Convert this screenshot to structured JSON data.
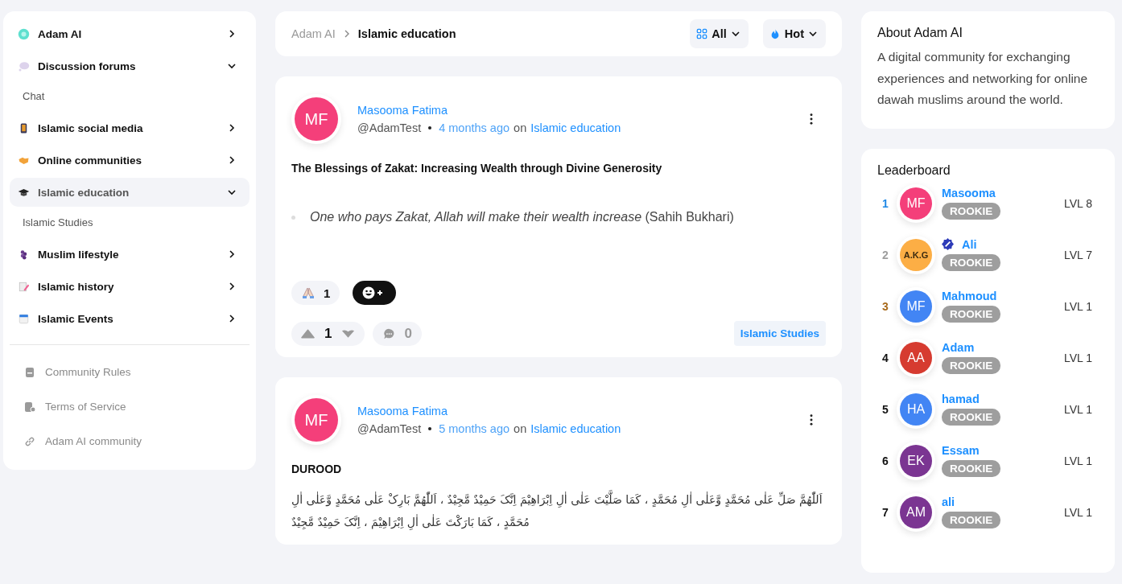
{
  "sidebar": {
    "items": [
      {
        "label": "Adam AI",
        "expanded": false,
        "selected": false
      },
      {
        "label": "Discussion forums",
        "expanded": true,
        "selected": false,
        "children": [
          {
            "label": "Chat"
          }
        ]
      },
      {
        "label": "Islamic social media",
        "expanded": false,
        "selected": false
      },
      {
        "label": "Online communities",
        "expanded": false,
        "selected": false
      },
      {
        "label": "Islamic education",
        "expanded": true,
        "selected": true,
        "children": [
          {
            "label": "Islamic Studies"
          }
        ]
      },
      {
        "label": "Muslim lifestyle",
        "expanded": false,
        "selected": false
      },
      {
        "label": "Islamic history",
        "expanded": false,
        "selected": false
      },
      {
        "label": "Islamic Events",
        "expanded": false,
        "selected": false
      }
    ],
    "links": [
      {
        "label": "Community Rules"
      },
      {
        "label": "Terms of Service"
      },
      {
        "label": "Adam AI community"
      }
    ]
  },
  "breadcrumb": {
    "parent": "Adam AI",
    "current": "Islamic education"
  },
  "filters": [
    {
      "label": "All"
    },
    {
      "label": "Hot"
    }
  ],
  "posts": [
    {
      "avatar": "MF",
      "color": "#f43f7a",
      "author": "Masooma Fatima",
      "handle": "@AdamTest",
      "time": "4 months ago",
      "on": "on",
      "community": "Islamic education",
      "title": "The Blessings of Zakat: Increasing Wealth through Divine Generosity",
      "kind": "quote",
      "body": "*One who pays Zakat, Allah will make their wealth increase* (Sahih Bukhari)",
      "reactions": [
        {
          "count": "1"
        }
      ],
      "votes": "1",
      "comments": "0",
      "tag": "Islamic Studies"
    },
    {
      "avatar": "MF",
      "color": "#f43f7a",
      "author": "Masooma Fatima",
      "handle": "@AdamTest",
      "time": "5 months ago",
      "on": "on",
      "community": "Islamic education",
      "title": "DUROOD",
      "kind": "arabic",
      "body": "اَللّٰهُمَّ صَلِّ عَلٰی مُحَمَّدٍ وَّعَلٰی اٰلِ مُحَمَّدٍ ، کَمَا صَلَّیْتَ عَلٰی اٰلِ اِبْرَاهِیْمَ اِنَّکَ حَمِیْدٌ مَّجِیْدٌ ، اَللّٰهُمَّ بَارِکْ عَلٰی مُحَمَّدٍ وَّعَلٰی اٰلِ مُحَمَّدٍ ، کَمَا بَارَکْتَ عَلٰی اٰلِ اِبْرَاهِیْمَ ، اِنَّکَ حَمِیْدٌ مَّجِیْدٌ"
    }
  ],
  "about": {
    "title": "About Adam AI",
    "text": "A digital community for exchanging experiences and networking for online dawah muslims around the world."
  },
  "leaderboard": {
    "title": "Leaderboard",
    "rows": [
      {
        "rank": "1",
        "avatar": "MF",
        "color": "#f43f7a",
        "kind": "initials",
        "verified": false,
        "name": "Masooma",
        "badge": "ROOKIE",
        "level": "LVL 8"
      },
      {
        "rank": "2",
        "avatar": "A.K.G",
        "color": "#fcae45",
        "kind": "logo",
        "verified": true,
        "name": "Ali",
        "badge": "ROOKIE",
        "level": "LVL 7"
      },
      {
        "rank": "3",
        "avatar": "MF",
        "color": "#4285f4",
        "kind": "initials",
        "verified": false,
        "name": "Mahmoud",
        "badge": "ROOKIE",
        "level": "LVL 1"
      },
      {
        "rank": "4",
        "avatar": "AA",
        "color": "#d63b30",
        "kind": "initials",
        "verified": false,
        "name": "Adam",
        "badge": "ROOKIE",
        "level": "LVL 1"
      },
      {
        "rank": "5",
        "avatar": "HA",
        "color": "#4285f4",
        "kind": "initials",
        "verified": false,
        "name": "hamad",
        "badge": "ROOKIE",
        "level": "LVL 1"
      },
      {
        "rank": "6",
        "avatar": "EK",
        "color": "#7b3592",
        "kind": "initials",
        "verified": false,
        "name": "Essam",
        "badge": "ROOKIE",
        "level": "LVL 1"
      },
      {
        "rank": "7",
        "avatar": "AM",
        "color": "#7b3592",
        "kind": "initials",
        "verified": false,
        "name": "ali",
        "badge": "ROOKIE",
        "level": "LVL 1"
      }
    ]
  }
}
